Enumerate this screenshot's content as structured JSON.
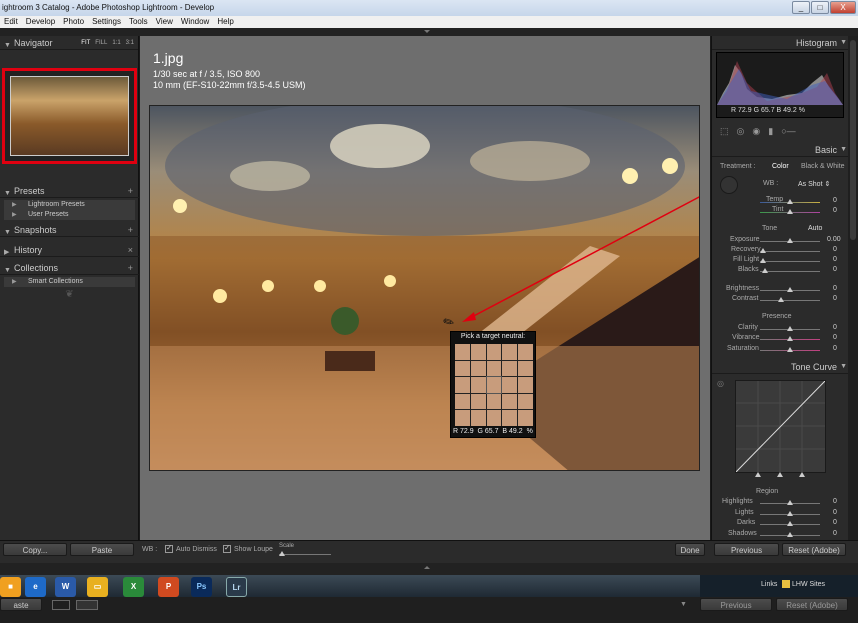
{
  "window": {
    "title": "ightroom 3 Catalog - Adobe Photoshop Lightroom - Develop",
    "minimize": "_",
    "maximize": "□",
    "close": "X"
  },
  "menu": [
    "Edit",
    "Develop",
    "Photo",
    "Settings",
    "Tools",
    "View",
    "Window",
    "Help"
  ],
  "left": {
    "navigator": {
      "title": "Navigator",
      "zoom": [
        "FIT",
        "FILL",
        "1:1",
        "3:1"
      ]
    },
    "presets": {
      "title": "Presets",
      "items": [
        "Lightroom Presets",
        "User Presets"
      ]
    },
    "snapshots": {
      "title": "Snapshots"
    },
    "history": {
      "title": "History"
    },
    "collections": {
      "title": "Collections",
      "items": [
        "Smart Collections"
      ]
    },
    "copy_label": "Copy...",
    "paste_label": "Paste"
  },
  "photo": {
    "filename": "1.jpg",
    "exposure": "1/30 sec at f / 3.5, ISO 800",
    "lens": "10 mm (EF-S10-22mm f/3.5-4.5 USM)"
  },
  "picker": {
    "title": "Pick a target neutral:",
    "r": "R 72.9",
    "g": "G 65.7",
    "b": "B 49.2",
    "unit": "%"
  },
  "right": {
    "histogram": {
      "title": "Histogram",
      "readout": "R 72.9   G 65.7   B 49.2 %"
    },
    "basic": {
      "title": "Basic",
      "treatment_label": "Treatment :",
      "treatment_color": "Color",
      "treatment_bw": "Black & White",
      "wb_label": "WB :",
      "wb_value": "As Shot ⇕",
      "temp_label": "Temp",
      "temp_value": "0",
      "tint_label": "Tint",
      "tint_value": "0",
      "tone_label": "Tone",
      "auto_label": "Auto",
      "exposure_label": "Exposure",
      "exposure_value": "0.00",
      "recovery_label": "Recovery",
      "recovery_value": "0",
      "filllight_label": "Fill Light",
      "filllight_value": "0",
      "blacks_label": "Blacks",
      "blacks_value": "0",
      "brightness_label": "Brightness",
      "brightness_value": "0",
      "contrast_label": "Contrast",
      "contrast_value": "0",
      "presence_label": "Presence",
      "clarity_label": "Clarity",
      "clarity_value": "0",
      "vibrance_label": "Vibrance",
      "vibrance_value": "0",
      "saturation_label": "Saturation",
      "saturation_value": "0"
    },
    "tonecurve": {
      "title": "Tone Curve",
      "region_label": "Region",
      "highlights_label": "Highlights",
      "highlights_value": "0",
      "lights_label": "Lights",
      "lights_value": "0",
      "darks_label": "Darks",
      "darks_value": "0",
      "shadows_label": "Shadows",
      "shadows_value": "0"
    },
    "previous_label": "Previous",
    "reset_label": "Reset (Adobe)"
  },
  "toolbar": {
    "wb_label": "WB :",
    "auto_dismiss": "Auto Dismiss",
    "show_loupe": "Show Loupe",
    "scale_label": "Scale",
    "done_label": "Done"
  },
  "taskbar": {
    "links_label": "Links",
    "lhw_label": "LHW Sites",
    "ghost_paste": "aste",
    "ghost_previous": "Previous",
    "ghost_reset": "Reset (Adobe)"
  }
}
